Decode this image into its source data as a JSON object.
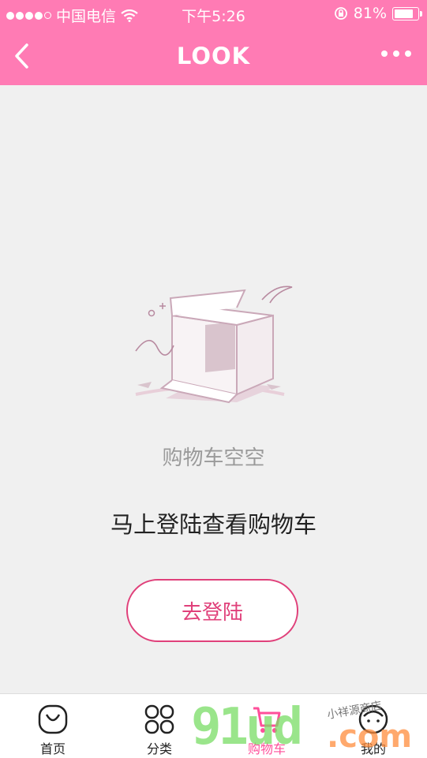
{
  "status_bar": {
    "carrier": "中国电信",
    "time": "下午5:26",
    "battery_text": "81%",
    "battery_level": 0.81
  },
  "nav": {
    "title": "LOOK",
    "back_icon": "chevron-left-icon",
    "more_icon": "more-dots-icon"
  },
  "empty_state": {
    "caption": "购物车空空",
    "prompt": "马上登陆查看购物车",
    "button_label": "去登陆"
  },
  "tab_bar": {
    "items": [
      {
        "label": "首页",
        "icon": "bag-icon",
        "active": false
      },
      {
        "label": "分类",
        "icon": "grid-icon",
        "active": false
      },
      {
        "label": "购物车",
        "icon": "cart-icon",
        "active": true
      },
      {
        "label": "我的",
        "icon": "user-icon",
        "active": false
      }
    ]
  },
  "watermark": {
    "digits": "91ud",
    "suffix": ".com",
    "script": "小祥源商店"
  },
  "colors": {
    "brand": "#ff7bb4",
    "accent": "#e0407a",
    "active_tab": "#ff4f9a",
    "background": "#f0f0f0"
  }
}
